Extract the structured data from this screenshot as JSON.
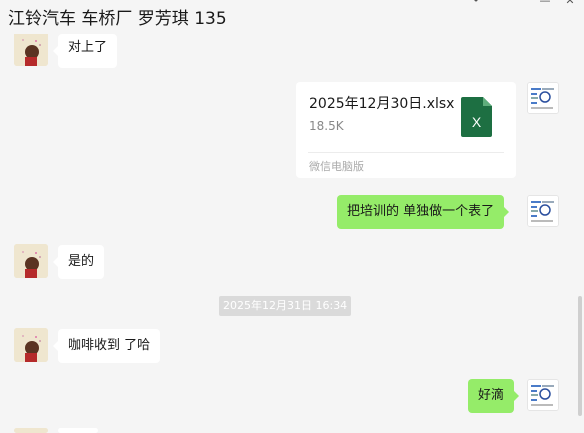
{
  "window": {
    "title": "江铃汽车 车桥厂 罗芳琪 135"
  },
  "messages": [
    {
      "sender": "other",
      "text": "对上了"
    },
    {
      "sender": "me",
      "type": "file",
      "file_name": "2025年12月30日.xlsx",
      "file_size": "18.5K",
      "file_source": "微信电脑版",
      "file_icon": "excel-icon",
      "file_icon_letter": "X"
    },
    {
      "sender": "me",
      "text": "把培训的 单独做一个表了"
    },
    {
      "sender": "other",
      "text": "是的"
    },
    {
      "sender": "system",
      "text": "2025年12月31日 16:34"
    },
    {
      "sender": "other",
      "text": "咖啡收到 了哈"
    },
    {
      "sender": "me",
      "text": "好滴"
    }
  ],
  "colors": {
    "background": "#f5f5f5",
    "outgoing_bubble": "#95ec69",
    "incoming_bubble": "#ffffff",
    "excel_green": "#1d6f42"
  }
}
